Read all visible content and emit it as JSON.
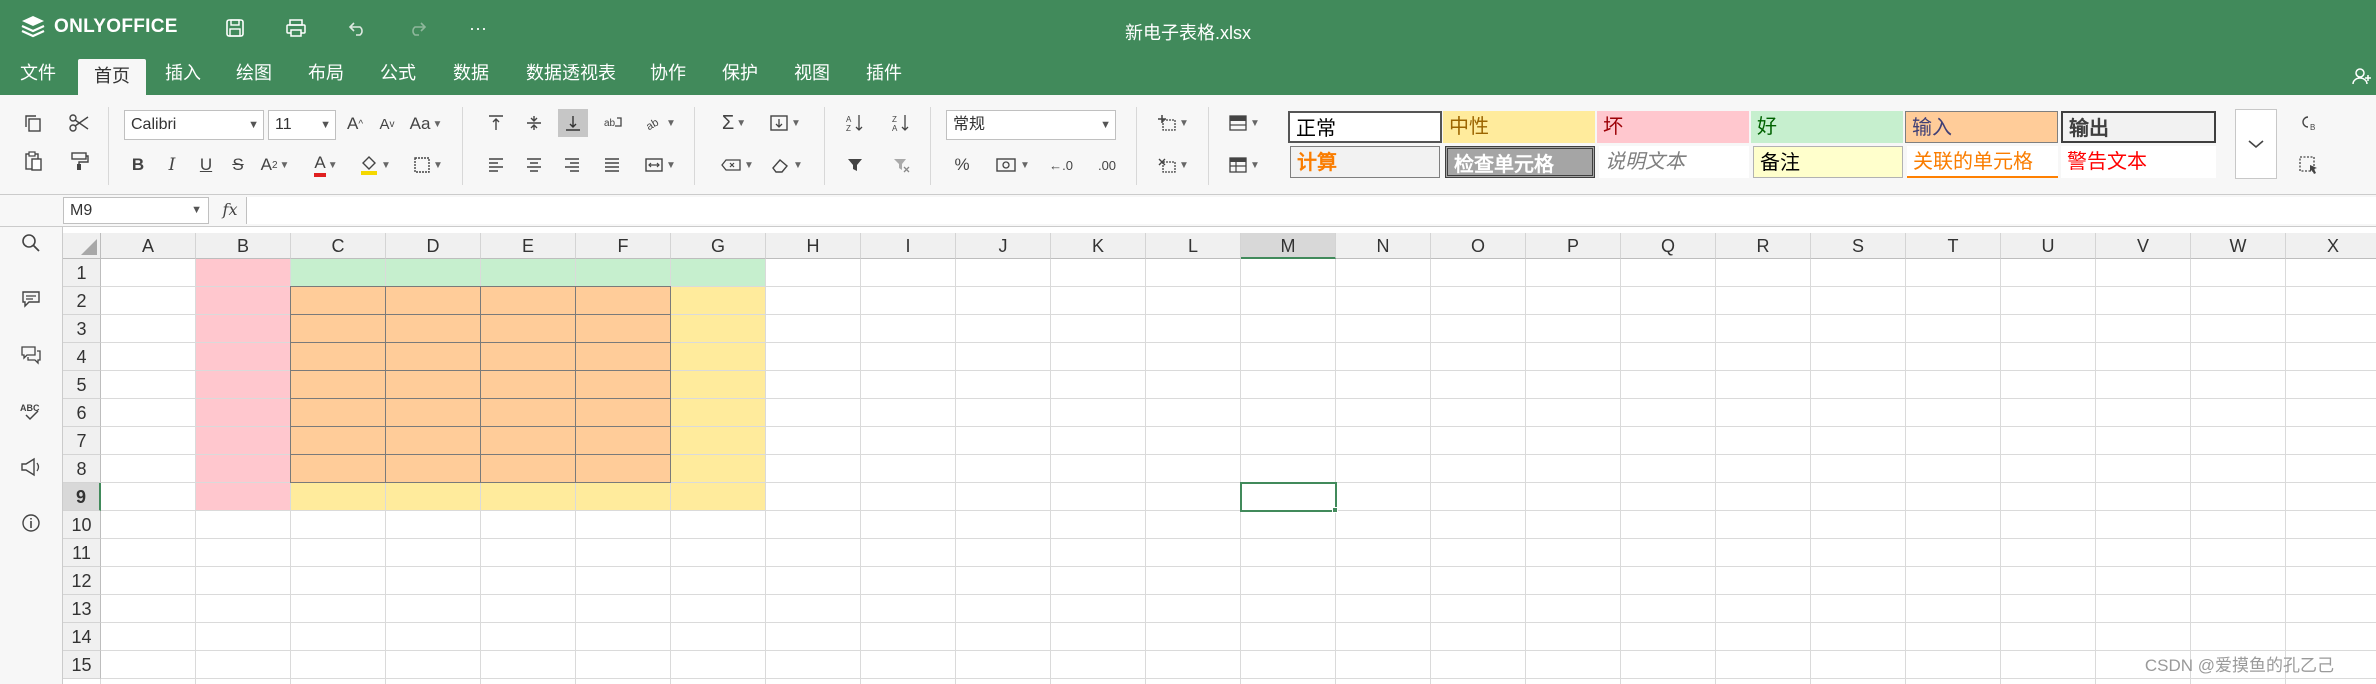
{
  "app": {
    "name": "ONLYOFFICE",
    "document_title": "新电子表格.xlsx"
  },
  "menu": [
    "文件",
    "首页",
    "插入",
    "绘图",
    "布局",
    "公式",
    "数据",
    "数据透视表",
    "协作",
    "保护",
    "视图",
    "插件"
  ],
  "active_menu": "首页",
  "toolbar": {
    "font_name": "Calibri",
    "font_size": "11",
    "number_format": "常规",
    "bold": "B",
    "italic": "I",
    "underline": "U",
    "strike": "S",
    "font_color_letter": "A",
    "percent": "%",
    "decrease_decimal": ".0",
    "increase_decimal": ".00",
    "increase_font": "A",
    "decrease_font": "A",
    "case": "Aa",
    "subscript": "A"
  },
  "cell_styles": [
    {
      "label": "正常",
      "bg": "#ffffff",
      "color": "#000000"
    },
    {
      "label": "中性",
      "bg": "#ffeb9c",
      "color": "#9c6500"
    },
    {
      "label": "坏",
      "bg": "#ffc7ce",
      "color": "#9c0006"
    },
    {
      "label": "好",
      "bg": "#c6efce",
      "color": "#006100"
    },
    {
      "label": "输入",
      "bg": "#ffcc99",
      "color": "#3f3f76"
    },
    {
      "label": "输出",
      "bg": "#f2f2f2",
      "color": "#3f3f3f"
    },
    {
      "label": "计算",
      "bg": "#f2f2f2",
      "color": "#fa7d00"
    },
    {
      "label": "检查单元格",
      "bg": "#a5a5a5",
      "color": "#ffffff"
    },
    {
      "label": "说明文本",
      "bg": "#ffffff",
      "color": "#7f7f7f"
    },
    {
      "label": "备注",
      "bg": "#ffffcc",
      "color": "#000000"
    },
    {
      "label": "关联的单元格",
      "bg": "#ffffff",
      "color": "#fa7d00"
    },
    {
      "label": "警告文本",
      "bg": "#ffffff",
      "color": "#ff0000"
    }
  ],
  "formula_bar": {
    "name_box": "M9",
    "fx": "fx",
    "formula": ""
  },
  "sheet": {
    "columns": [
      "A",
      "B",
      "C",
      "D",
      "E",
      "F",
      "G",
      "H",
      "I",
      "J",
      "K",
      "L",
      "M",
      "N",
      "O",
      "P",
      "Q",
      "R",
      "S",
      "T",
      "U",
      "V",
      "W",
      "X"
    ],
    "rows": [
      "1",
      "2",
      "3",
      "4",
      "5",
      "6",
      "7",
      "8",
      "9",
      "10",
      "11",
      "12",
      "13",
      "14",
      "15"
    ],
    "selected_cell": "M9",
    "fills": [
      {
        "range": "B1:B9",
        "color": "#ffc7ce"
      },
      {
        "range": "C1:G1",
        "color": "#c6efce"
      },
      {
        "range": "G2:G9",
        "color": "#ffeb9c"
      },
      {
        "range": "C9:F9",
        "color": "#ffeb9c"
      },
      {
        "range": "C2:F8",
        "color": "#ffcc99",
        "bordered": true
      }
    ]
  },
  "watermark": "CSDN @爱摸鱼的孔乙己",
  "colors": {
    "brand": "#418a5b",
    "toolbar_bg": "#f7f7f7"
  }
}
